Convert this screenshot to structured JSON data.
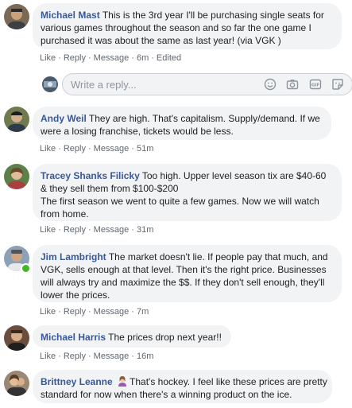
{
  "actions": {
    "like": "Like",
    "reply": "Reply",
    "message": "Message",
    "separator": "·"
  },
  "reply_box": {
    "placeholder": "Write a reply..."
  },
  "comments": [
    {
      "author": "Michael Mast",
      "lines": [
        "This is the 3rd year I'll be purchasing single seats for",
        "various games throughout the season and so far the one game I",
        "purchased it was about the same as last year! (via VGK )"
      ],
      "time": "6m",
      "edited": "Edited"
    },
    {
      "author": "Andy Weil",
      "lines": [
        "They are high. That's capitalism. Supply/demand. If we",
        "were a losing franchise, tickets would be less."
      ],
      "time": "51m"
    },
    {
      "author": "Tracey Shanks Filicky",
      "lines": [
        "Too high. Upper level season tix are $40-60",
        "& they sell them from $100-$200",
        "The first season we went to quite a few games. Now we will watch",
        "from home."
      ],
      "time": "31m"
    },
    {
      "author": "Jim Lambright",
      "lines": [
        "The market doesn't lie. If people pay that much, and",
        "VGK, sells enough at that level. Then it's the right price. Businesses",
        "will always try and maximize the $$. If they don't sell enough, they'll",
        "lower the prices."
      ],
      "time": "7m"
    },
    {
      "author": "Michael Harris",
      "lines": [
        "The prices drop next year!!"
      ],
      "time": "16m"
    },
    {
      "author": "Brittney Leanne",
      "lines": [
        "That's hockey. I feel like these prices are pretty",
        "standard for now when there's a winning product on the ice."
      ]
    }
  ]
}
